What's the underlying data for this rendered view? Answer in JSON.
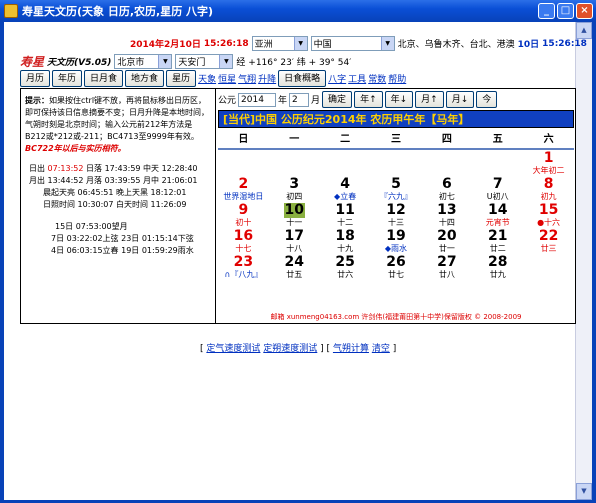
{
  "window": {
    "title": "寿星天文历(天象 日历,农历,星历 八字)",
    "minimize": "_",
    "maximize": "□",
    "close": "×"
  },
  "top": {
    "date": "2014年2月10日",
    "time": "15:26:18",
    "region": "亚洲",
    "country": "中国",
    "clocks_label": "北京、乌鲁木齐、台北、港澳",
    "clock_date": "10日",
    "clock_time": "15:26:18"
  },
  "row2": {
    "logo": "寿星",
    "logo2": "天文历(V5.05)",
    "city": "北京市",
    "place": "天安门",
    "coord": "经 +116° 23′ 纬 + 39° 54′"
  },
  "buttons": [
    "月历",
    "年历",
    "日月食",
    "地方食",
    "星历"
  ],
  "links": [
    "天象",
    "恒星",
    "气翔",
    "升降"
  ],
  "eclipse_button": "日食概略",
  "links2": [
    "八字",
    "工具",
    "常数",
    "帮助"
  ],
  "left": {
    "tip_label": "提示：",
    "tip": "如果按住ctrl键不放，再将鼠标移出日历区，即可保持该日信息摘要不变；日月升降是本地时间，气朔时刻是北京时间；输入公元前212年方法是B212或*212或-211；BC4713至9999年有效。",
    "warn": "BC722年以后与实历相符。",
    "lines": [
      [
        "日出",
        "07:13:52",
        "日落 17:43:59 中天 12:28:40"
      ],
      [
        "月出",
        "13:44:52",
        "月落 03:39:55 月中 21:06:01"
      ],
      [
        "",
        "",
        "晨起天亮 06:45:51 晚上天黑 18:12:01"
      ],
      [
        "",
        "",
        "日照时间 10:30:07 白天时间 11:26:09"
      ]
    ],
    "moon": [
      "15日 07:53:00望月",
      "7日 03:22:02上弦  23日 01:15:14下弦",
      "4日 06:03:15立春  19日 01:59:29雨水"
    ]
  },
  "cal": {
    "prefix": "公元",
    "year": "2014",
    "year_unit": "年",
    "month": "2",
    "month_unit": "月",
    "ok": "确定",
    "year_up": "年↑",
    "year_down": "年↓",
    "month_up": "月↑",
    "month_down": "月↓",
    "today": "今",
    "header": "[当代]中国  公历纪元2014年  农历甲午年【马年】",
    "weekdays": [
      "日",
      "一",
      "二",
      "三",
      "四",
      "五",
      "六"
    ],
    "days": [
      {
        "n": "",
        "s": ""
      },
      {
        "n": "",
        "s": ""
      },
      {
        "n": "",
        "s": ""
      },
      {
        "n": "",
        "s": ""
      },
      {
        "n": "",
        "s": ""
      },
      {
        "n": "",
        "s": ""
      },
      {
        "n": "1",
        "s": "大年初二",
        "c": "red"
      },
      {
        "n": "2",
        "s": "世界湿地日",
        "c": "red",
        "sc": "blue"
      },
      {
        "n": "3",
        "s": "初四"
      },
      {
        "n": "4",
        "s": "◆立春",
        "sc": "blue"
      },
      {
        "n": "5",
        "s": "『六九』",
        "sc": "blue"
      },
      {
        "n": "6",
        "s": "初七"
      },
      {
        "n": "7",
        "s": "U初八"
      },
      {
        "n": "8",
        "s": "初九",
        "c": "red"
      },
      {
        "n": "9",
        "s": "初十",
        "c": "red"
      },
      {
        "n": "10",
        "s": "十一",
        "hl": true
      },
      {
        "n": "11",
        "s": "十二"
      },
      {
        "n": "12",
        "s": "十三"
      },
      {
        "n": "13",
        "s": "十四"
      },
      {
        "n": "14",
        "s": "元宵节",
        "sc": "red"
      },
      {
        "n": "15",
        "s": "●十六",
        "c": "red"
      },
      {
        "n": "16",
        "s": "十七",
        "c": "red"
      },
      {
        "n": "17",
        "s": "十八"
      },
      {
        "n": "18",
        "s": "十九"
      },
      {
        "n": "19",
        "s": "◆雨水",
        "sc": "blue"
      },
      {
        "n": "20",
        "s": "廿一"
      },
      {
        "n": "21",
        "s": "廿二"
      },
      {
        "n": "22",
        "s": "廿三",
        "c": "red"
      },
      {
        "n": "23",
        "s": "∩『八九』",
        "c": "red",
        "sc": "blue"
      },
      {
        "n": "24",
        "s": "廿五"
      },
      {
        "n": "25",
        "s": "廿六"
      },
      {
        "n": "26",
        "s": "廿七"
      },
      {
        "n": "27",
        "s": "廿八"
      },
      {
        "n": "28",
        "s": "廿九"
      },
      {
        "n": "",
        "s": ""
      }
    ],
    "footer": "邮箱 xunmeng04163.com 许剑伟(福建莆田第十中学)保留版权 © 2008-2009"
  },
  "bottom": {
    "open": "[",
    "l1": "定气速度测试",
    "l2": "定朔速度测试",
    "mid": "] [",
    "l3": "气朔计算",
    "l4": "清空",
    "close": "]"
  }
}
